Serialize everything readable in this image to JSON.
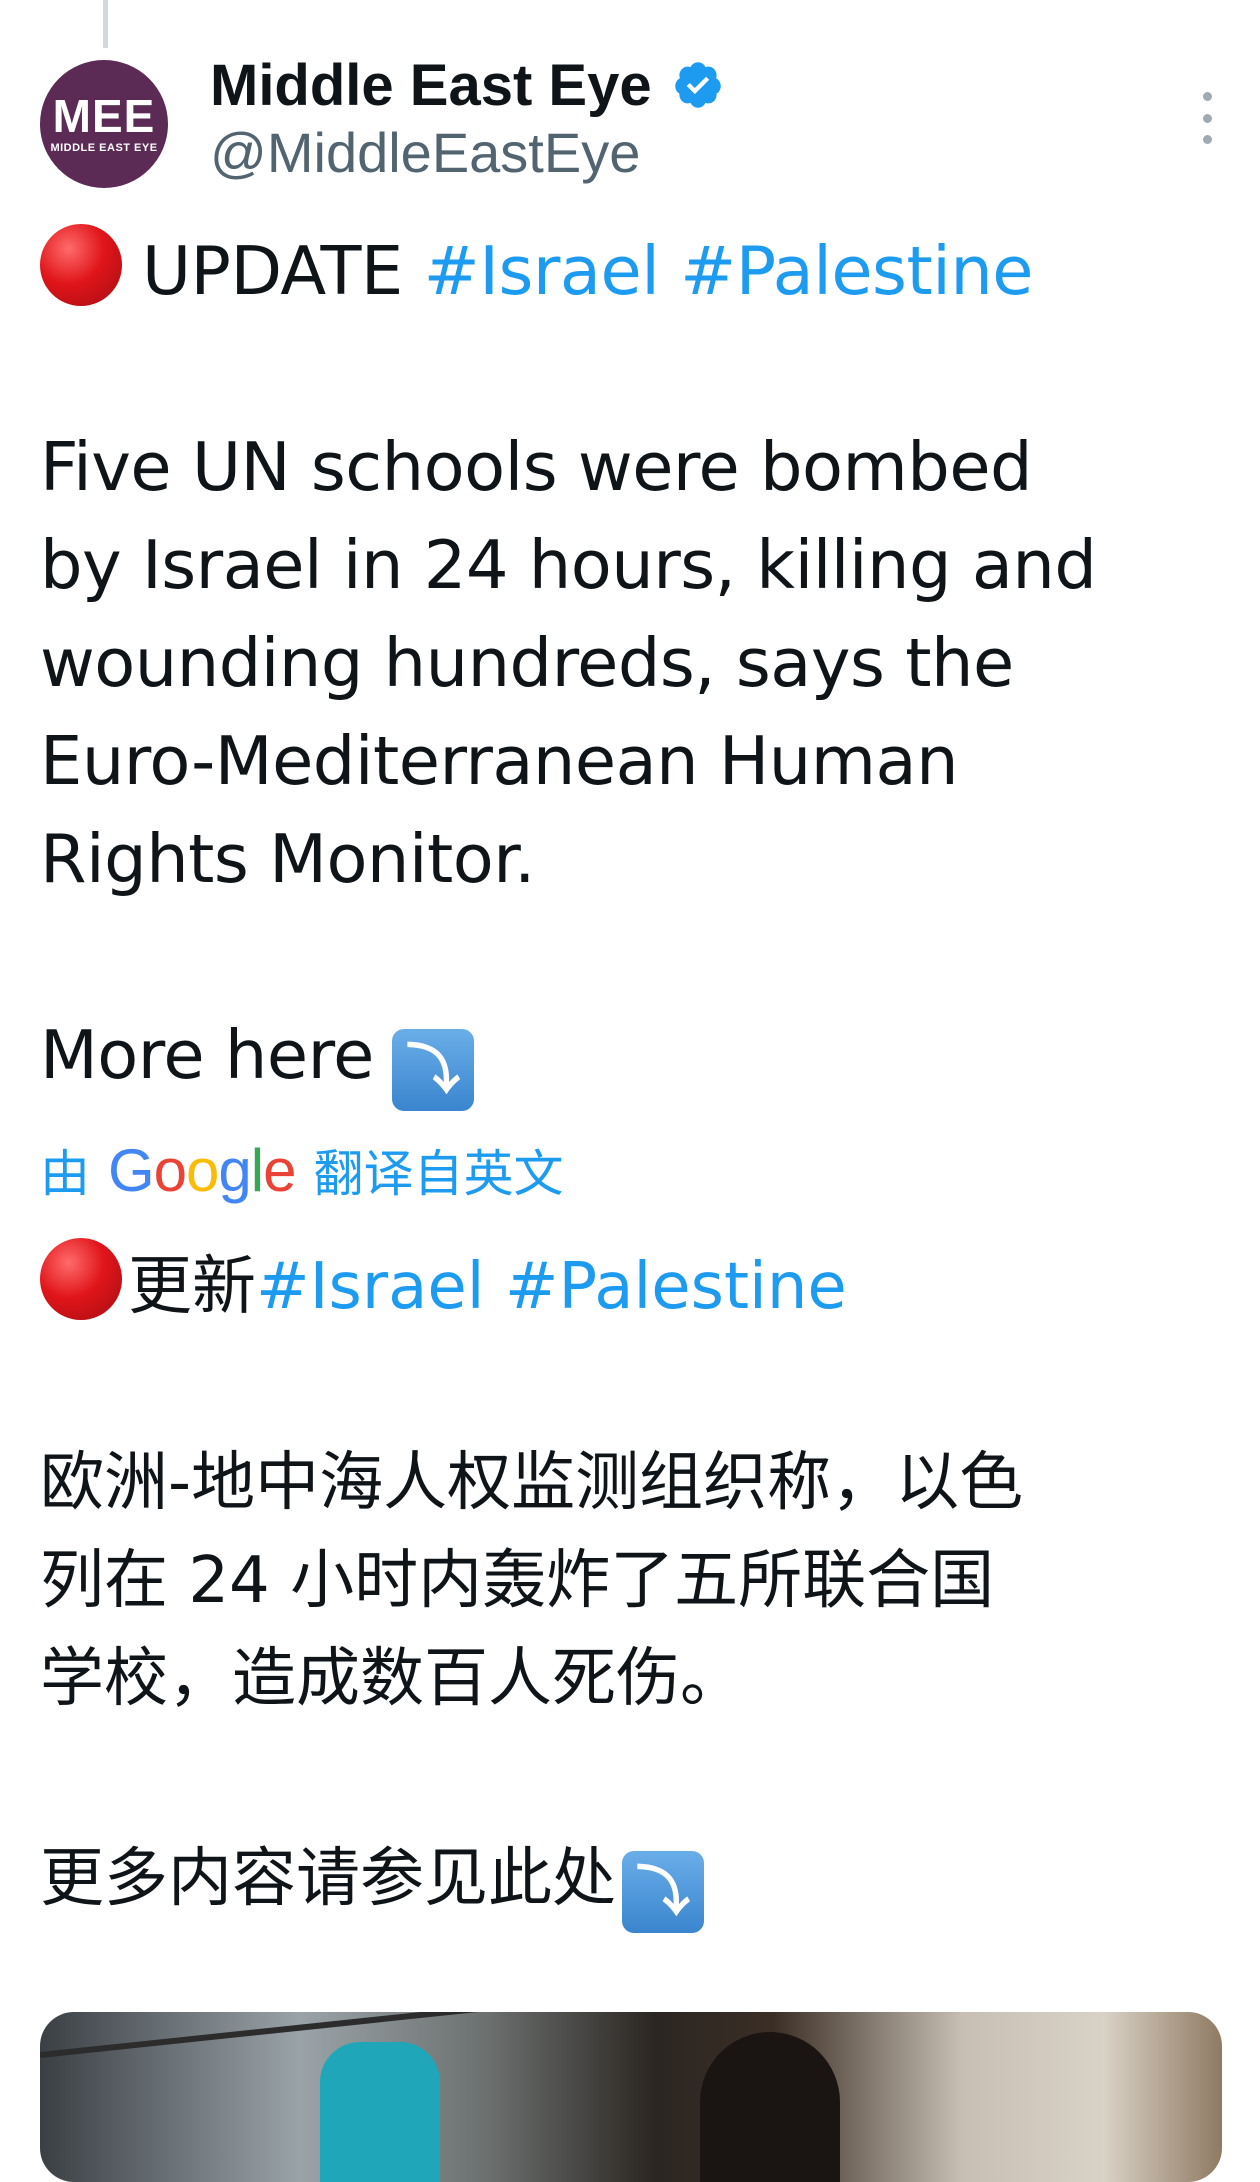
{
  "tweet": {
    "author": {
      "display_name": "Middle East Eye",
      "handle": "@MiddleEastEye",
      "verified": true,
      "avatar_logo_text": "MEE",
      "avatar_logo_subtext": "MIDDLE EAST EYE",
      "avatar_color": "#5b2a55"
    },
    "original": {
      "headline_word": "UPDATE",
      "hashtags": [
        "#Israel",
        "#Palestine"
      ],
      "body_lines": [
        "Five UN schools were bombed",
        "by Israel in 24 hours, killing and",
        "wounding hundreds, says the",
        "Euro-Mediterranean Human",
        "Rights Monitor."
      ],
      "more_text": "More here",
      "more_emoji": "arrow-down-right-icon"
    },
    "translation_note": {
      "prefix": "由",
      "provider": "Google",
      "suffix": "翻译自英文"
    },
    "translated": {
      "headline_word": "更新",
      "hashtags": [
        "#Israel",
        "#Palestine"
      ],
      "body_lines": [
        "欧洲-地中海人权监测组织称，以色",
        "列在 24 小时内轰炸了五所联合国",
        "学校，造成数百人死伤。"
      ],
      "more_text": "更多内容请参见此处"
    },
    "colors": {
      "text": "#0f1419",
      "secondary_text": "#536471",
      "link": "#1d9bf0",
      "verified_badge": "#1d9bf0"
    }
  }
}
